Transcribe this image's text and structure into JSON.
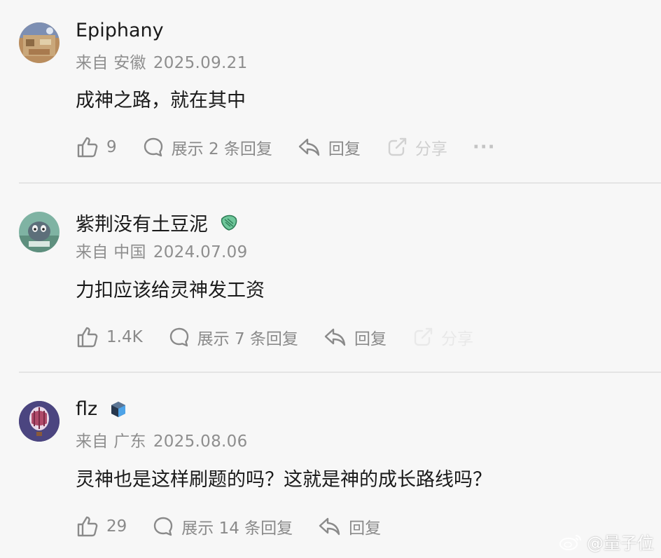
{
  "comments": [
    {
      "username": "Epiphany",
      "location": "来自 安徽",
      "date": "2025.09.21",
      "text": "成神之路，就在其中",
      "likes": "9",
      "replies_label": "展示 2 条回复",
      "reply_label": "回复",
      "share_label": "分享",
      "more_label": "···"
    },
    {
      "username": "紫荆没有土豆泥",
      "location": "来自 中国",
      "date": "2024.07.09",
      "text": "力扣应该给灵神发工资",
      "likes": "1.4K",
      "replies_label": "展示 7 条回复",
      "reply_label": "回复",
      "share_label": "分享"
    },
    {
      "username": "flz",
      "location": "来自 广东",
      "date": "2025.08.06",
      "text": "灵神也是这样刷题的吗？这就是神的成长路线吗？",
      "likes": "29",
      "replies_label": "展示 14 条回复",
      "reply_label": "回复"
    }
  ],
  "watermark": {
    "text": "@量子位",
    "icon": "weibo-icon"
  },
  "colors": {
    "background": "#f7f7f7",
    "text": "#1a1a1a",
    "muted": "#8e8e8e",
    "divider": "#e4e4e4"
  }
}
